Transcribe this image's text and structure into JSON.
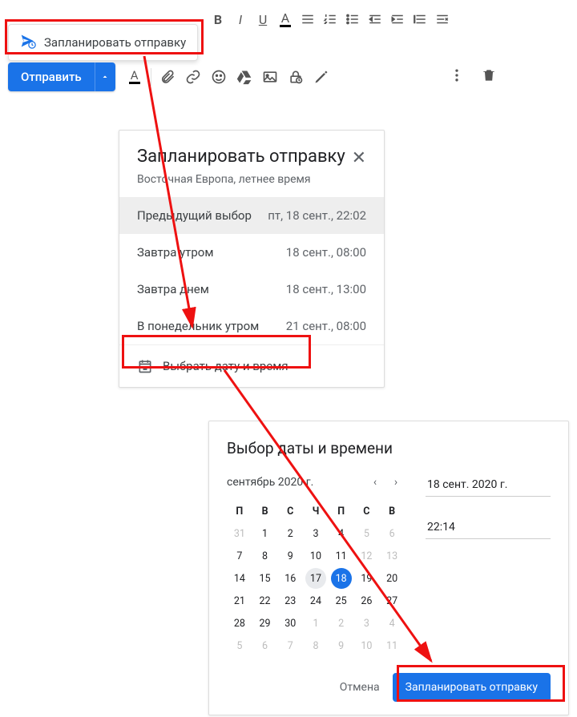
{
  "menu": {
    "schedule": "Запланировать отправку"
  },
  "send": {
    "label": "Отправить"
  },
  "popup1": {
    "title": "Запланировать отправку",
    "timezone": "Восточная Европа, летнее время",
    "rows": [
      {
        "label": "Предыдущий выбор",
        "time": "пт, 18 сент., 22:02"
      },
      {
        "label": "Завтра утром",
        "time": "18 сент., 08:00"
      },
      {
        "label": "Завтра днем",
        "time": "18 сент., 13:00"
      },
      {
        "label": "В понедельник утром",
        "time": "21 сент., 08:00"
      }
    ],
    "pick": "Выбрать дату и время"
  },
  "picker": {
    "title": "Выбор даты и времени",
    "month": "сентябрь 2020 г.",
    "dow": [
      "П",
      "В",
      "С",
      "Ч",
      "П",
      "С",
      "В"
    ],
    "dateField": "18 сент. 2020 г.",
    "timeField": "22:14",
    "cancel": "Отмена",
    "confirm": "Запланировать отправку",
    "weeks": [
      [
        {
          "n": "31",
          "o": true
        },
        {
          "n": "1"
        },
        {
          "n": "2"
        },
        {
          "n": "3"
        },
        {
          "n": "4"
        },
        {
          "n": "5",
          "o": true
        },
        {
          "n": "6",
          "o": true
        }
      ],
      [
        {
          "n": "7"
        },
        {
          "n": "8"
        },
        {
          "n": "9"
        },
        {
          "n": "10"
        },
        {
          "n": "11"
        },
        {
          "n": "12",
          "o": true
        },
        {
          "n": "13",
          "o": true
        }
      ],
      [
        {
          "n": "14"
        },
        {
          "n": "15"
        },
        {
          "n": "16"
        },
        {
          "n": "17",
          "t": true
        },
        {
          "n": "18",
          "s": true
        },
        {
          "n": "19"
        },
        {
          "n": "20"
        }
      ],
      [
        {
          "n": "21"
        },
        {
          "n": "22"
        },
        {
          "n": "23"
        },
        {
          "n": "24"
        },
        {
          "n": "25"
        },
        {
          "n": "26"
        },
        {
          "n": "27"
        }
      ],
      [
        {
          "n": "28"
        },
        {
          "n": "29"
        },
        {
          "n": "30"
        },
        {
          "n": "1",
          "o": true
        },
        {
          "n": "2",
          "o": true
        },
        {
          "n": "3",
          "o": true
        },
        {
          "n": "4",
          "o": true
        }
      ],
      [
        {
          "n": "5",
          "o": true
        },
        {
          "n": "6",
          "o": true
        },
        {
          "n": "7",
          "o": true
        },
        {
          "n": "8",
          "o": true
        },
        {
          "n": "9",
          "o": true
        },
        {
          "n": "10",
          "o": true
        },
        {
          "n": "11",
          "o": true
        }
      ]
    ]
  }
}
